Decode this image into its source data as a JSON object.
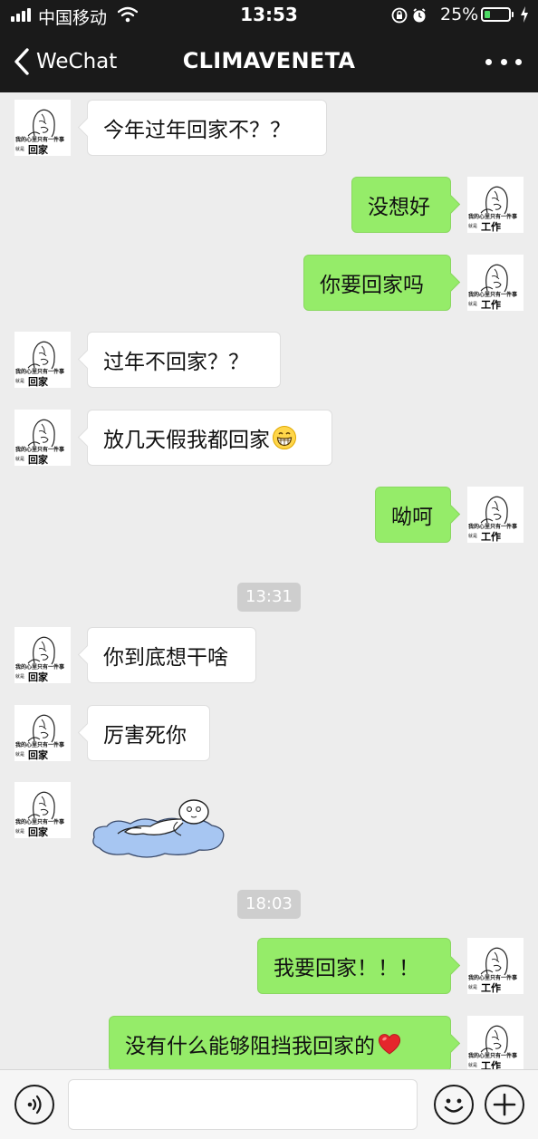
{
  "status_bar": {
    "carrier": "中国移动",
    "time": "13:53",
    "battery": "25%",
    "battery_level": 0.25
  },
  "nav": {
    "back_label": "WeChat",
    "title": "CLIMAVENETA",
    "more_icon": "ellipsis-icon"
  },
  "avatars": {
    "contact": {
      "caption_top": "我的心里只有一件事",
      "caption_small": "就是",
      "caption_main": "回家"
    },
    "me": {
      "caption_top": "我的心里只有一件事",
      "caption_small": "就是",
      "caption_main": "工作"
    }
  },
  "messages": [
    {
      "side": "left",
      "text": "今年过年回家不？？"
    },
    {
      "side": "right",
      "text": "没想好"
    },
    {
      "side": "right",
      "text": "你要回家吗"
    },
    {
      "side": "left",
      "text": "过年不回家？？"
    },
    {
      "side": "left",
      "text": "放几天假我都回家",
      "emoji": "grinning-face-emoji"
    },
    {
      "side": "right",
      "text": "呦呵"
    },
    {
      "type": "time",
      "text": "13:31"
    },
    {
      "side": "left",
      "text": "你到底想干啥"
    },
    {
      "side": "left",
      "text": "厉害死你"
    },
    {
      "side": "left",
      "type": "sticker",
      "sticker": "person-lying-in-puddle-sticker"
    },
    {
      "type": "time",
      "text": "18:03"
    },
    {
      "side": "right",
      "text": "我要回家！！！"
    },
    {
      "side": "right",
      "text": "没有什么能够阻挡我回家的",
      "emoji": "red-heart-emoji"
    }
  ],
  "input_bar": {
    "voice_icon": "voice-icon",
    "emoji_icon": "smiley-icon",
    "plus_icon": "plus-icon",
    "placeholder": ""
  },
  "colors": {
    "nav_bg": "#1a1a1a",
    "chat_bg": "#ededed",
    "outgoing_bubble": "#95ec69",
    "incoming_bubble": "#ffffff",
    "time_badge": "#cecece",
    "battery_fill": "#4cd964"
  }
}
